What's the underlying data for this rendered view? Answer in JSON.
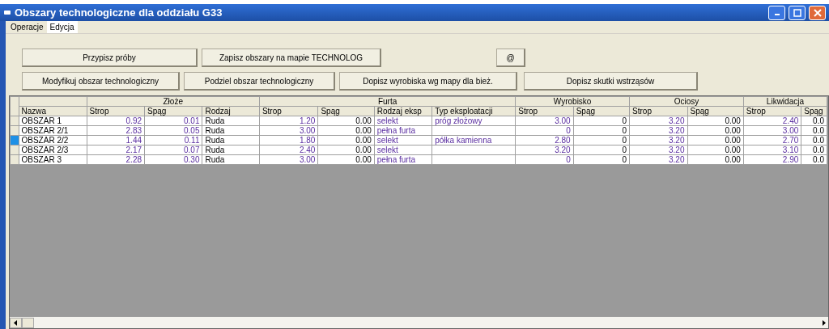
{
  "window": {
    "title": "Obszary technologiczne dla oddziału G33"
  },
  "menu": [
    {
      "label": "Operacje",
      "selected": false
    },
    {
      "label": "Edycja",
      "selected": true
    }
  ],
  "button_rows": [
    [
      {
        "label": "Przypisz próby",
        "kind": "wide"
      },
      {
        "label": "Zapisz obszary na mapie TECHNOLOG",
        "kind": "wide"
      },
      {
        "label": "@",
        "kind": "small"
      }
    ],
    [
      {
        "label": "Modyfikuj obszar technologiczny",
        "kind": "wide"
      },
      {
        "label": "Podziel obszar technologiczny",
        "kind": "wide"
      },
      {
        "label": "Dopisz wyrobiska wg mapy dla bież.",
        "kind": "wide"
      },
      {
        "label": "Dopisz skutki wstrząsów",
        "kind": "wide"
      }
    ]
  ],
  "table": {
    "groups": [
      {
        "columns": [
          {
            "label": "Nazwa",
            "kind": "text"
          }
        ]
      },
      {
        "label": "Złoże",
        "columns": [
          {
            "label": "Strop",
            "kind": "accent-number"
          },
          {
            "label": "Spąg",
            "kind": "accent-number"
          },
          {
            "label": "Rodzaj",
            "kind": "text"
          }
        ]
      },
      {
        "label": "Furta",
        "columns": [
          {
            "label": "Strop",
            "kind": "accent-number"
          },
          {
            "label": "Spąg",
            "kind": "number"
          },
          {
            "label": "Rodzaj eksp",
            "kind": "accent-text"
          },
          {
            "label": "Typ eksploatacji",
            "kind": "accent-text"
          }
        ]
      },
      {
        "label": "Wyrobisko",
        "columns": [
          {
            "label": "Strop",
            "kind": "accent-number"
          },
          {
            "label": "Spąg",
            "kind": "number"
          }
        ]
      },
      {
        "label": "Ociosy",
        "columns": [
          {
            "label": "Strop",
            "kind": "accent-number"
          },
          {
            "label": "Spąg",
            "kind": "number"
          }
        ]
      },
      {
        "label": "Likwidacja",
        "columns": [
          {
            "label": "Strop",
            "kind": "accent-number"
          },
          {
            "label": "Spąg",
            "kind": "number"
          }
        ]
      }
    ],
    "rows": [
      {
        "selected": false,
        "cells": [
          "OBSZAR  1",
          "0.92",
          "0.01",
          "Ruda",
          "1.20",
          "0.00",
          "selekt",
          "próg złożowy",
          "3.00",
          "0",
          "3.20",
          "0.00",
          "2.40",
          "0.0"
        ]
      },
      {
        "selected": false,
        "cells": [
          "OBSZAR  2/1",
          "2.83",
          "0.05",
          "Ruda",
          "3.00",
          "0.00",
          "pełna furta",
          "",
          "0",
          "0",
          "3.20",
          "0.00",
          "3.00",
          "0.0"
        ]
      },
      {
        "selected": true,
        "cells": [
          "OBSZAR  2/2",
          "1.44",
          "0.11",
          "Ruda",
          "1.80",
          "0.00",
          "selekt",
          "półka kamienna",
          "2.80",
          "0",
          "3.20",
          "0.00",
          "2.70",
          "0.0"
        ]
      },
      {
        "selected": false,
        "cells": [
          "OBSZAR  2/3",
          "2.17",
          "0.07",
          "Ruda",
          "2.40",
          "0.00",
          "selekt",
          "",
          "3.20",
          "0",
          "3.20",
          "0.00",
          "3.10",
          "0.0"
        ]
      },
      {
        "selected": false,
        "cells": [
          "OBSZAR  3",
          "2.28",
          "0.30",
          "Ruda",
          "3.00",
          "0.00",
          "pełna furta",
          "",
          "0",
          "0",
          "3.20",
          "0.00",
          "2.90",
          "0.0"
        ]
      }
    ]
  }
}
